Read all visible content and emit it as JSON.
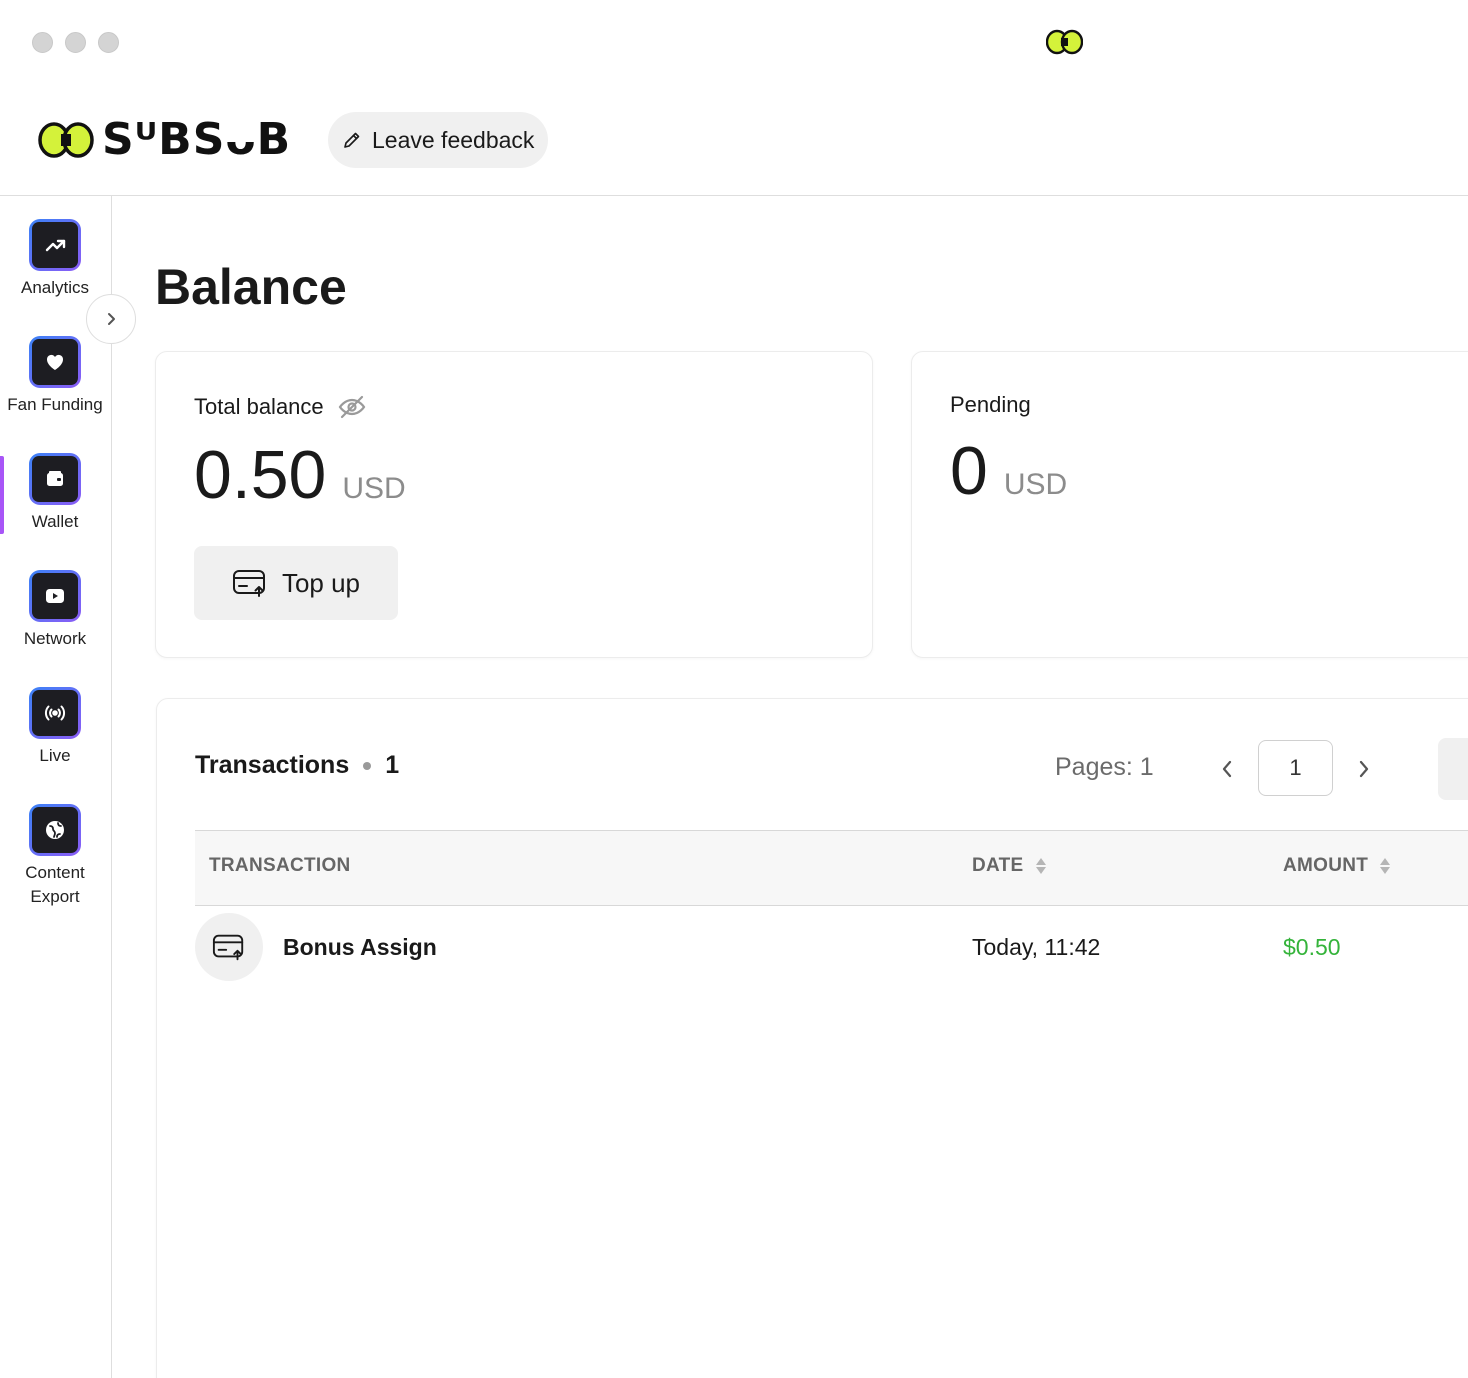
{
  "window": {
    "traffic_lights": [
      "close",
      "minimize",
      "zoom"
    ],
    "title_logo_icon": "subsub-logo-icon"
  },
  "header": {
    "brand_name": "SᵁBSᴗB",
    "brand_logo_icon": "subsub-logo-icon",
    "feedback_label": "Leave feedback",
    "feedback_icon": "pencil-icon",
    "accent_color": "#d4f23a"
  },
  "sidebar": {
    "active_item": "Wallet",
    "active_color": "#a855f7",
    "items": [
      {
        "label": "Analytics",
        "icon": "trending-up-icon"
      },
      {
        "label": "Fan Funding",
        "icon": "heart-icon"
      },
      {
        "label": "Wallet",
        "icon": "wallet-icon"
      },
      {
        "label": "Network",
        "icon": "play-icon"
      },
      {
        "label": "Live",
        "icon": "broadcast-icon"
      },
      {
        "label": "Content Export",
        "icon": "globe-icon"
      }
    ],
    "collapse_icon": "chevron-right-icon"
  },
  "main": {
    "title": "Balance",
    "total_balance": {
      "label": "Total balance",
      "visibility_icon": "eye-off-icon",
      "amount": "0.50",
      "currency": "USD",
      "topup_label": "Top up",
      "topup_icon": "card-upload-icon"
    },
    "pending": {
      "label": "Pending",
      "amount": "0",
      "currency": "USD"
    },
    "transactions": {
      "title": "Transactions",
      "count": "1",
      "pages_label": "Pages: 1",
      "current_page": "1",
      "columns": [
        "TRANSACTION",
        "DATE",
        "AMOUNT"
      ],
      "rows": [
        {
          "name": "Bonus Assign",
          "date": "Today, 11:42",
          "amount": "$0.50",
          "icon": "card-upload-icon",
          "amount_color": "#34b33a"
        }
      ]
    }
  }
}
